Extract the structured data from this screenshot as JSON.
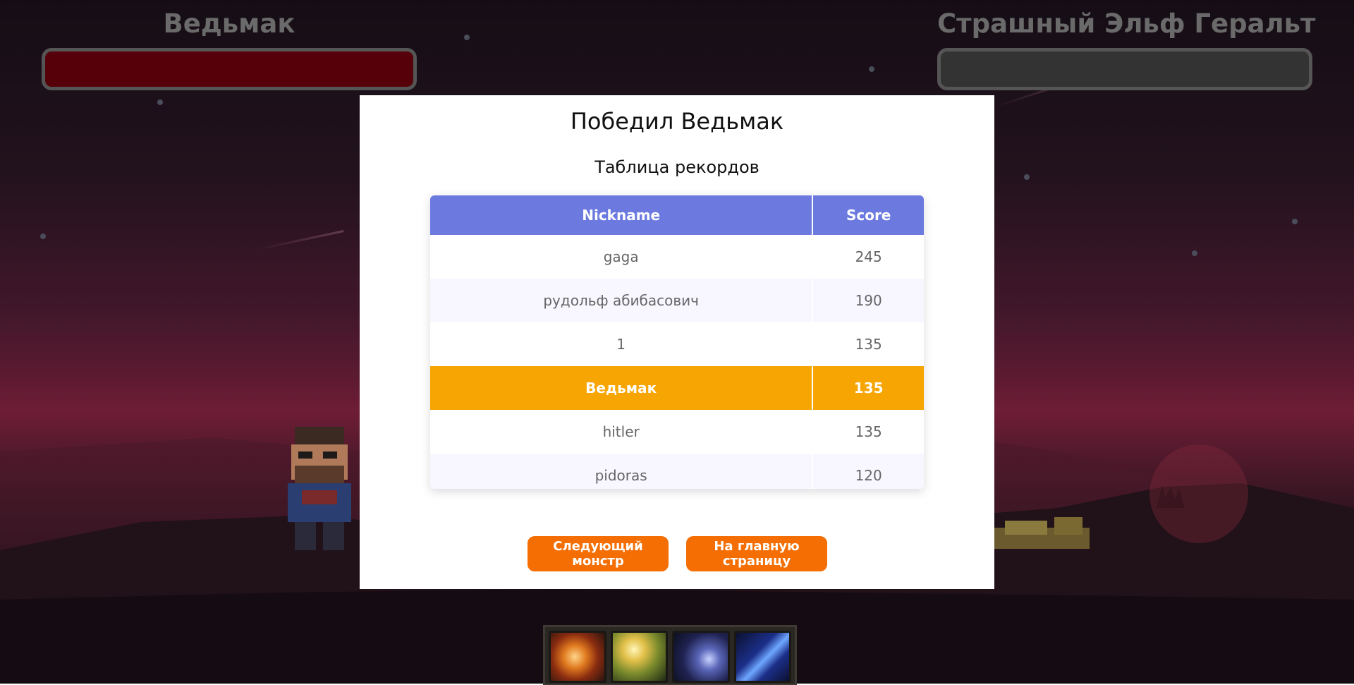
{
  "hud": {
    "player_name": "Ведьмак",
    "enemy_name": "Страшный Эльф Геральт",
    "player_health_fraction": 1.0,
    "enemy_health_fraction": 0.0
  },
  "modal": {
    "title": "Победил Ведьмак",
    "leaderboard_title": "Таблица рекордов",
    "columns": [
      "Nickname",
      "Score"
    ],
    "rows": [
      {
        "nickname": "gaga",
        "score": "245"
      },
      {
        "nickname": "рудольф абибасович",
        "score": "190"
      },
      {
        "nickname": "1",
        "score": "135"
      },
      {
        "nickname": "Ведьмак",
        "score": "135",
        "highlight": true
      },
      {
        "nickname": "hitler",
        "score": "135"
      },
      {
        "nickname": "pidoras",
        "score": "120"
      }
    ],
    "next_button": "Следующий монстр",
    "home_button": "На главную страницу"
  },
  "skills": [
    "fire-skill-icon",
    "nature-skill-icon",
    "comet-skill-icon",
    "storm-skill-icon"
  ],
  "colors": {
    "header": "#6c7ae0",
    "highlight_row": "#f7a502",
    "button": "#f46e03",
    "player_health": "#560009"
  }
}
